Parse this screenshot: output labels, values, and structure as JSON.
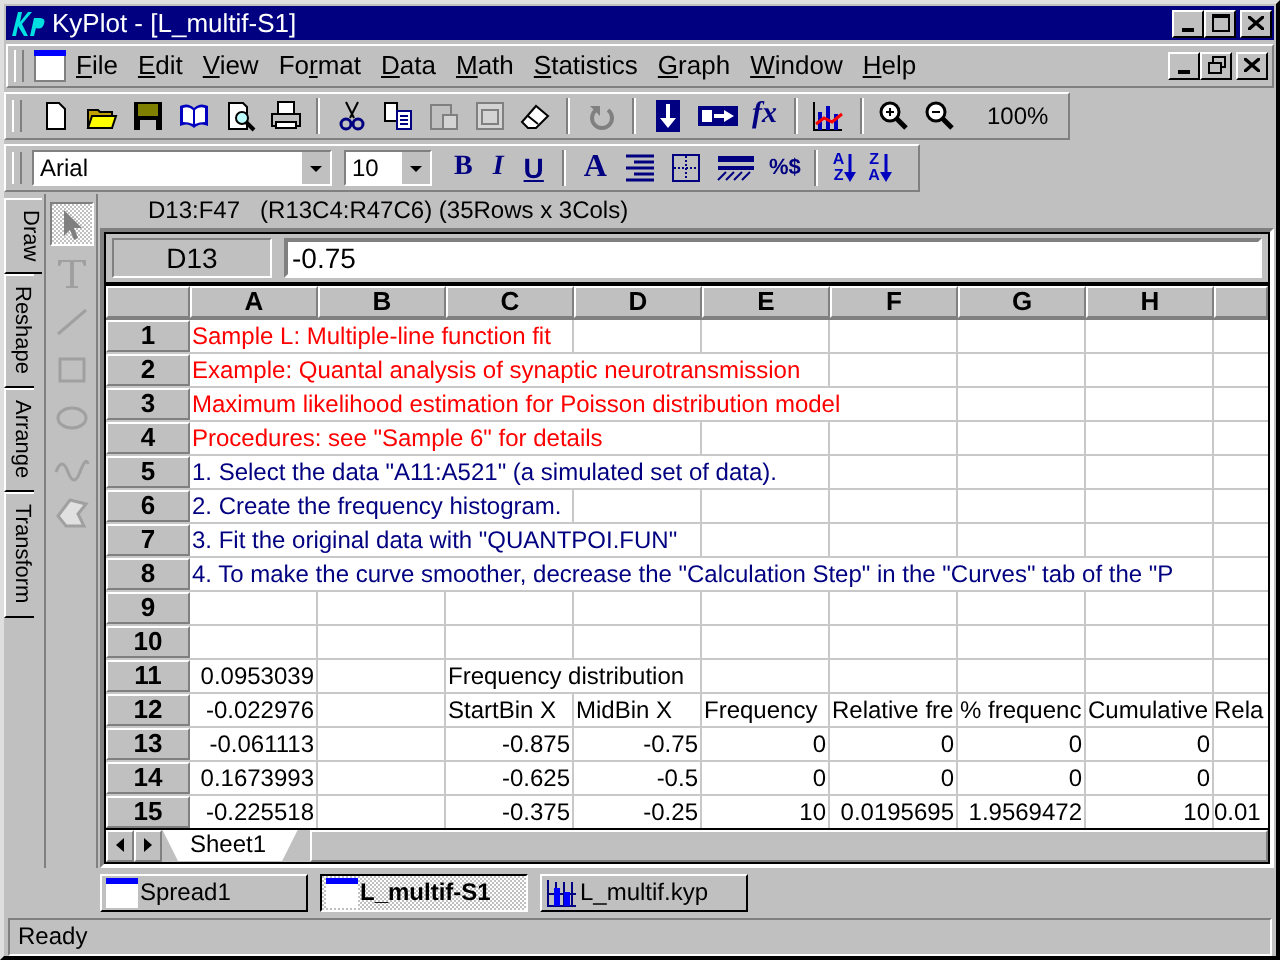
{
  "window": {
    "title": "KyPlot - [L_multif-S1]"
  },
  "menu": [
    {
      "key": "F",
      "after": "ile"
    },
    {
      "key": "E",
      "after": "dit"
    },
    {
      "key": "V",
      "after": "iew"
    },
    {
      "before": "Fo",
      "key": "r",
      "after": "mat"
    },
    {
      "key": "D",
      "after": "ata"
    },
    {
      "key": "M",
      "after": "ath"
    },
    {
      "key": "S",
      "after": "tatistics"
    },
    {
      "key": "G",
      "after": "raph"
    },
    {
      "key": "W",
      "after": "indow"
    },
    {
      "key": "H",
      "after": "elp"
    }
  ],
  "toolbar": {
    "function_button": "fx",
    "zoom": "100%"
  },
  "format_bar": {
    "font": "Arial",
    "size": "10",
    "style_buttons": [
      {
        "label": "B",
        "kind": "bold"
      },
      {
        "label": "I",
        "kind": "italic"
      },
      {
        "label": "U",
        "kind": "underline"
      }
    ],
    "color_button": "A",
    "number_format_button": "%$",
    "sort_buttons": [
      {
        "top": "A",
        "bottom": "Z"
      },
      {
        "top": "Z",
        "bottom": "A"
      }
    ]
  },
  "side_tabs": [
    {
      "label": "Draw",
      "selected": true
    },
    {
      "label": "Reshape",
      "selected": false
    },
    {
      "label": "Arrange",
      "selected": false
    },
    {
      "label": "Transform",
      "selected": false
    }
  ],
  "selection_info": {
    "range": "D13:F47",
    "detail": "(R13C4:R47C6) (35Rows x 3Cols)"
  },
  "sheet": {
    "cell_ref": "D13",
    "formula": "-0.75",
    "columns": [
      "A",
      "B",
      "C",
      "D",
      "E",
      "F",
      "G",
      "H"
    ],
    "rows": [
      {
        "number": "1",
        "cells": {
          "A": {
            "text": "Sample L: Multiple-line function fit",
            "kind": "text",
            "color": "#ff0000"
          }
        }
      },
      {
        "number": "2",
        "cells": {
          "A": {
            "text": "Example: Quantal analysis of synaptic neurotransmission",
            "kind": "text",
            "color": "#ff0000"
          }
        }
      },
      {
        "number": "3",
        "cells": {
          "A": {
            "text": "Maximum likelihood estimation for Poisson distribution model",
            "kind": "text",
            "color": "#ff0000"
          }
        }
      },
      {
        "number": "4",
        "cells": {
          "A": {
            "text": "Procedures: see \"Sample 6\" for details",
            "kind": "text",
            "color": "#ff0000"
          }
        }
      },
      {
        "number": "5",
        "cells": {
          "A": {
            "text": "1. Select the data \"A11:A521\" (a simulated set of data).",
            "kind": "text",
            "color": "#000080"
          }
        }
      },
      {
        "number": "6",
        "cells": {
          "A": {
            "text": "2. Create the frequency histogram.",
            "kind": "text",
            "color": "#000080"
          }
        }
      },
      {
        "number": "7",
        "cells": {
          "A": {
            "text": "3. Fit the original data with \"QUANTPOI.FUN\"",
            "kind": "text",
            "color": "#000080"
          }
        }
      },
      {
        "number": "8",
        "cells": {
          "A": {
            "text": "4. To make the curve smoother, decrease the \"Calculation Step\" in the \"Curves\" tab of the \"P",
            "kind": "text",
            "color": "#000080"
          }
        }
      },
      {
        "number": "9",
        "cells": {}
      },
      {
        "number": "10",
        "cells": {}
      },
      {
        "number": "11",
        "cells": {
          "A": {
            "text": "0.0953039",
            "kind": "number"
          },
          "C": {
            "text": "Frequency distribution",
            "kind": "text"
          }
        }
      },
      {
        "number": "12",
        "cells": {
          "A": {
            "text": "-0.022976",
            "kind": "number"
          },
          "C": {
            "text": "StartBin X",
            "kind": "text"
          },
          "D": {
            "text": "MidBin X",
            "kind": "text"
          },
          "E": {
            "text": "Frequency",
            "kind": "text"
          },
          "F": {
            "text": "Relative fre",
            "kind": "text"
          },
          "G": {
            "text": "% frequenc",
            "kind": "text"
          },
          "H": {
            "text": "Cumulative",
            "kind": "text"
          },
          "I": {
            "text": "Rela",
            "kind": "text"
          }
        }
      },
      {
        "number": "13",
        "cells": {
          "A": {
            "text": "-0.061113",
            "kind": "number"
          },
          "C": {
            "text": "-0.875",
            "kind": "number"
          },
          "D": {
            "text": "-0.75",
            "kind": "number"
          },
          "E": {
            "text": "0",
            "kind": "number"
          },
          "F": {
            "text": "0",
            "kind": "number"
          },
          "G": {
            "text": "0",
            "kind": "number"
          },
          "H": {
            "text": "0",
            "kind": "number"
          }
        }
      },
      {
        "number": "14",
        "cells": {
          "A": {
            "text": "0.1673993",
            "kind": "number"
          },
          "C": {
            "text": "-0.625",
            "kind": "number"
          },
          "D": {
            "text": "-0.5",
            "kind": "number"
          },
          "E": {
            "text": "0",
            "kind": "number"
          },
          "F": {
            "text": "0",
            "kind": "number"
          },
          "G": {
            "text": "0",
            "kind": "number"
          },
          "H": {
            "text": "0",
            "kind": "number"
          }
        }
      },
      {
        "number": "15",
        "cells": {
          "A": {
            "text": "-0.225518",
            "kind": "number"
          },
          "C": {
            "text": "-0.375",
            "kind": "number"
          },
          "D": {
            "text": "-0.25",
            "kind": "number"
          },
          "E": {
            "text": "10",
            "kind": "number"
          },
          "F": {
            "text": "0.0195695",
            "kind": "number"
          },
          "G": {
            "text": "1.9569472",
            "kind": "number"
          },
          "H": {
            "text": "10",
            "kind": "number"
          },
          "I": {
            "text": "0.01",
            "kind": "text"
          }
        }
      }
    ],
    "tabs": [
      {
        "label": "Sheet1",
        "selected": true
      }
    ]
  },
  "window_tabs": [
    {
      "label": "Spread1",
      "kind": "sheet",
      "selected": false
    },
    {
      "label": "L_multif-S1",
      "kind": "sheet",
      "selected": true
    },
    {
      "label": "L_multif.kyp",
      "kind": "graph",
      "selected": false
    }
  ],
  "status_bar": "Ready"
}
